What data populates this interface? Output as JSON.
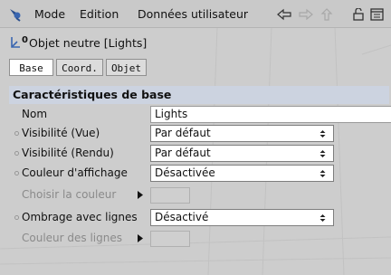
{
  "menubar": {
    "app_icon": "cinema-lamp-icon",
    "items": [
      "Mode",
      "Edition",
      "Données utilisateur"
    ],
    "icons": [
      "arrow-left-icon",
      "arrow-right-icon",
      "arrow-up-icon",
      "lock-icon",
      "panel-icon"
    ]
  },
  "object": {
    "icon": "null-object-icon",
    "title": "Objet neutre [Lights]"
  },
  "tabs": [
    {
      "label": "Base",
      "active": true
    },
    {
      "label": "Coord.",
      "active": false
    },
    {
      "label": "Objet",
      "active": false
    }
  ],
  "section": {
    "title": "Caractéristiques de base"
  },
  "properties": {
    "nom": {
      "label": "Nom",
      "value": "Lights"
    },
    "visibilite_vue": {
      "label": "Visibilité (Vue)",
      "value": "Par défaut"
    },
    "visibilite_rendu": {
      "label": "Visibilité (Rendu)",
      "value": "Par défaut"
    },
    "couleur_affichage": {
      "label": "Couleur d'affichage",
      "value": "Désactivée"
    },
    "choisir_couleur": {
      "label": "Choisir la couleur"
    },
    "ombrage_lignes": {
      "label": "Ombrage avec lignes",
      "value": "Désactivé"
    },
    "couleur_lignes": {
      "label": "Couleur des lignes"
    }
  },
  "colors": {
    "background": "#cdcdcd",
    "section_header": "#ccd3e0",
    "field": "#ffffff",
    "disabled_text": "#8a8a8a",
    "accent_icon": "#2b4f8c"
  }
}
